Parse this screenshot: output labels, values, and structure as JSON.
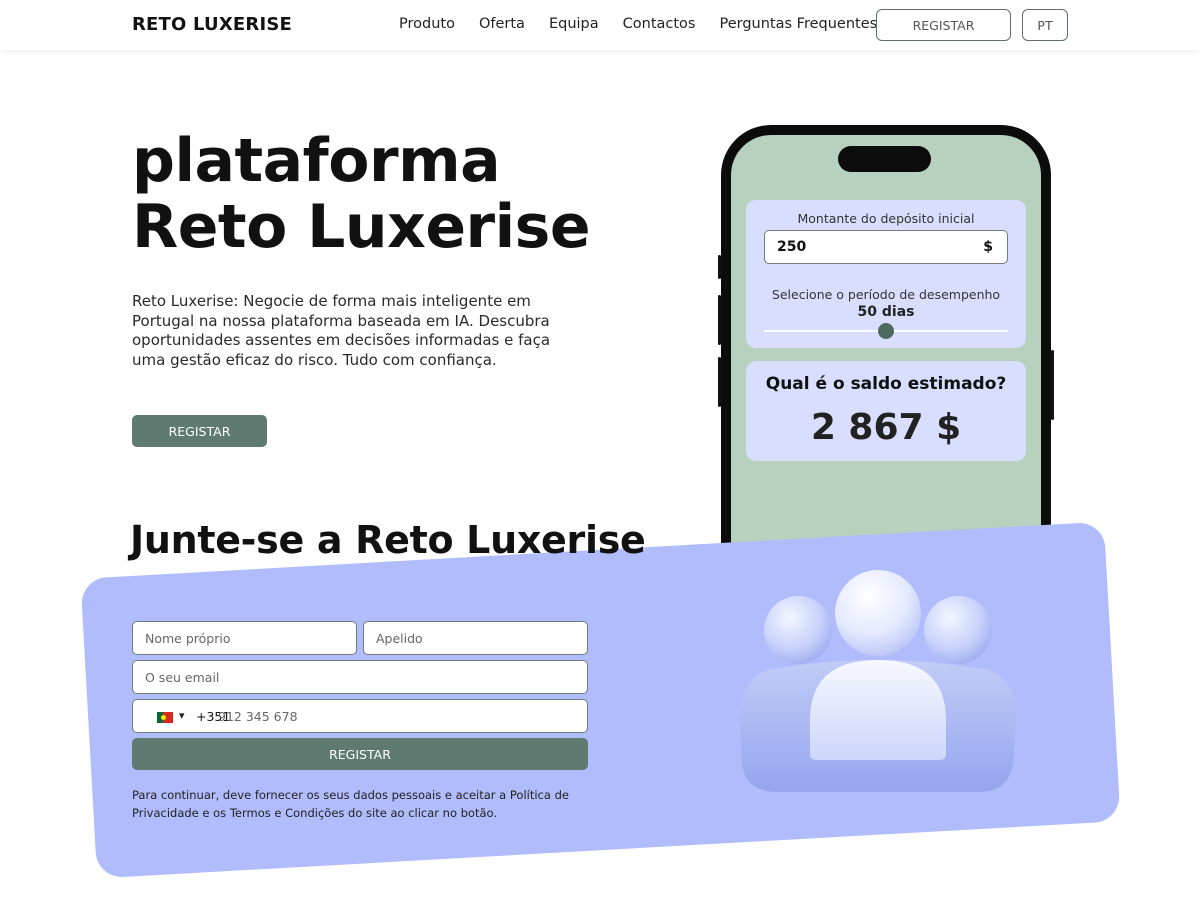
{
  "header": {
    "logo": "RETO LUXERISE",
    "nav": [
      "Produto",
      "Oferta",
      "Equipa",
      "Contactos",
      "Perguntas Frequentes"
    ],
    "register_label": "REGISTAR",
    "language_label": "PT"
  },
  "hero": {
    "title_line1": "plataforma",
    "title_line2": "Reto Luxerise",
    "description": "Reto Luxerise: Negocie de forma mais inteligente em Portugal na nossa plataforma baseada em IA. Descubra oportunidades assentes em decisões informadas e faça uma gestão eficaz do risco. Tudo com confiança.",
    "register_label": "REGISTAR"
  },
  "calculator": {
    "deposit_label": "Montante do depósito inicial",
    "deposit_value": "250",
    "currency": "$",
    "period_label": "Selecione o período de desempenho",
    "period_value": "50 dias",
    "slider_fraction": 0.5,
    "result_question": "Qual é o saldo estimado?",
    "result_value": "2 867 $"
  },
  "join": {
    "title": "Junte-se a Reto Luxerise",
    "first_name_placeholder": "Nome próprio",
    "last_name_placeholder": "Apelido",
    "email_placeholder": "O seu email",
    "country_flag": "portugal-flag-icon",
    "dial_code": "+351",
    "phone_placeholder": "912 345 678",
    "register_label": "REGISTAR",
    "consent_text": "Para continuar, deve fornecer os seus dados pessoais e aceitar a Política de Privacidade e os Termos e Condições do site ao clicar no botão."
  },
  "colors": {
    "accent_green": "#5f7a71",
    "phone_screen": "#b6d1bd",
    "card_lavender": "#d9deff",
    "join_background": "#b0bcfc"
  }
}
